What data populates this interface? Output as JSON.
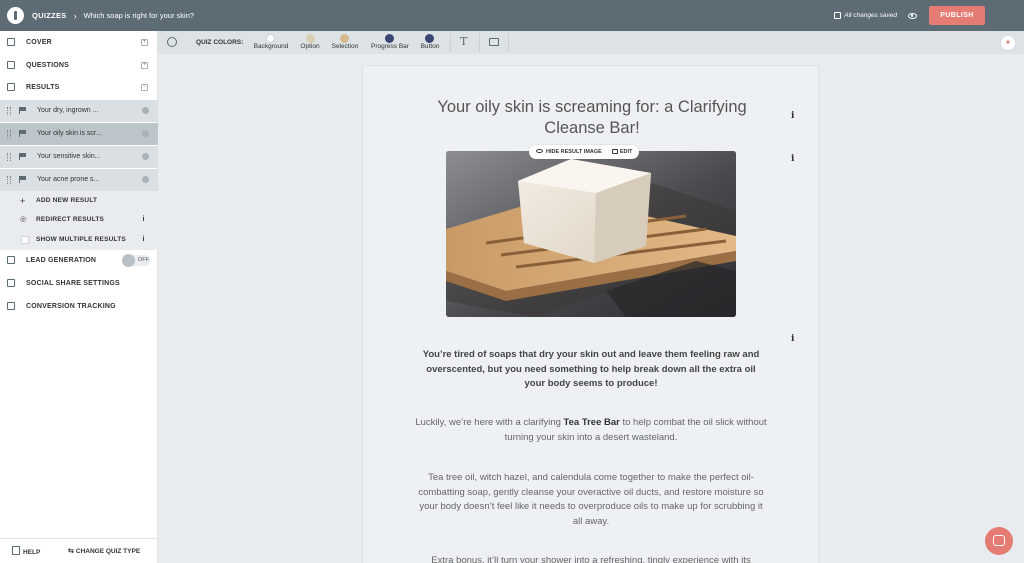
{
  "topbar": {
    "breadcrumb_root": "QUIZZES",
    "breadcrumb_sep": "›",
    "quiz_title": "Which soap is right for your skin?",
    "saved_status": "All changes saved",
    "publish_label": "PUBLISH"
  },
  "sidebar": {
    "cover": "COVER",
    "questions": "QUESTIONS",
    "results": "RESULTS",
    "result_items": [
      {
        "label": "Your dry, ingrown ..."
      },
      {
        "label": "Your oily skin is scr..."
      },
      {
        "label": "Your sensitive skin..."
      },
      {
        "label": "Your acne prone s..."
      }
    ],
    "add_new_result": "ADD NEW RESULT",
    "redirect_results": "REDIRECT RESULTS",
    "show_multiple_results": "SHOW MULTIPLE RESULTS",
    "lead_generation": "LEAD GENERATION",
    "lead_toggle_state": "OFF",
    "social_share_settings": "SOCIAL SHARE SETTINGS",
    "conversion_tracking": "CONVERSION TRACKING",
    "help": "HELP",
    "change_quiz_type": "CHANGE QUIZ TYPE"
  },
  "toolbar": {
    "quiz_colors_label": "QUIZ COLORS:",
    "swatches": [
      {
        "label": "Background",
        "color": "#ffffff"
      },
      {
        "label": "Option",
        "color": "#d8cfb6"
      },
      {
        "label": "Selection",
        "color": "#d6b98e"
      },
      {
        "label": "Progress Bar",
        "color": "#3a4675"
      },
      {
        "label": "Button",
        "color": "#3a4675"
      }
    ]
  },
  "result": {
    "heading": "Your oily skin is screaming for: a Clarifying Cleanse Bar!",
    "hide_image_label": "HIDE RESULT IMAGE",
    "edit_label": "EDIT",
    "intro_bold": "You’re tired of soaps that dry your skin out and leave them feeling raw and overscented, but you need something to help break down all the extra oil your body seems to produce!",
    "para2_before": "Luckily, we’re here with a clarifying ",
    "para2_bold": "Tea Tree Bar",
    "para2_after": " to help combat the oil slick without turning your skin into a desert wasteland.",
    "para3": "Tea tree oil, witch hazel, and calendula come together to make the perfect oil-combatting soap, gently cleanse your overactive oil ducts, and restore moisture so your body doesn’t feel like it needs to overproduce oils to make up for scrubbing it all away.",
    "para4": "Extra bonus, it’ll turn your shower into a refreshing, tingly experience with its"
  },
  "colors": {
    "topbar": "#5d6b74",
    "accent": "#e57c73"
  }
}
